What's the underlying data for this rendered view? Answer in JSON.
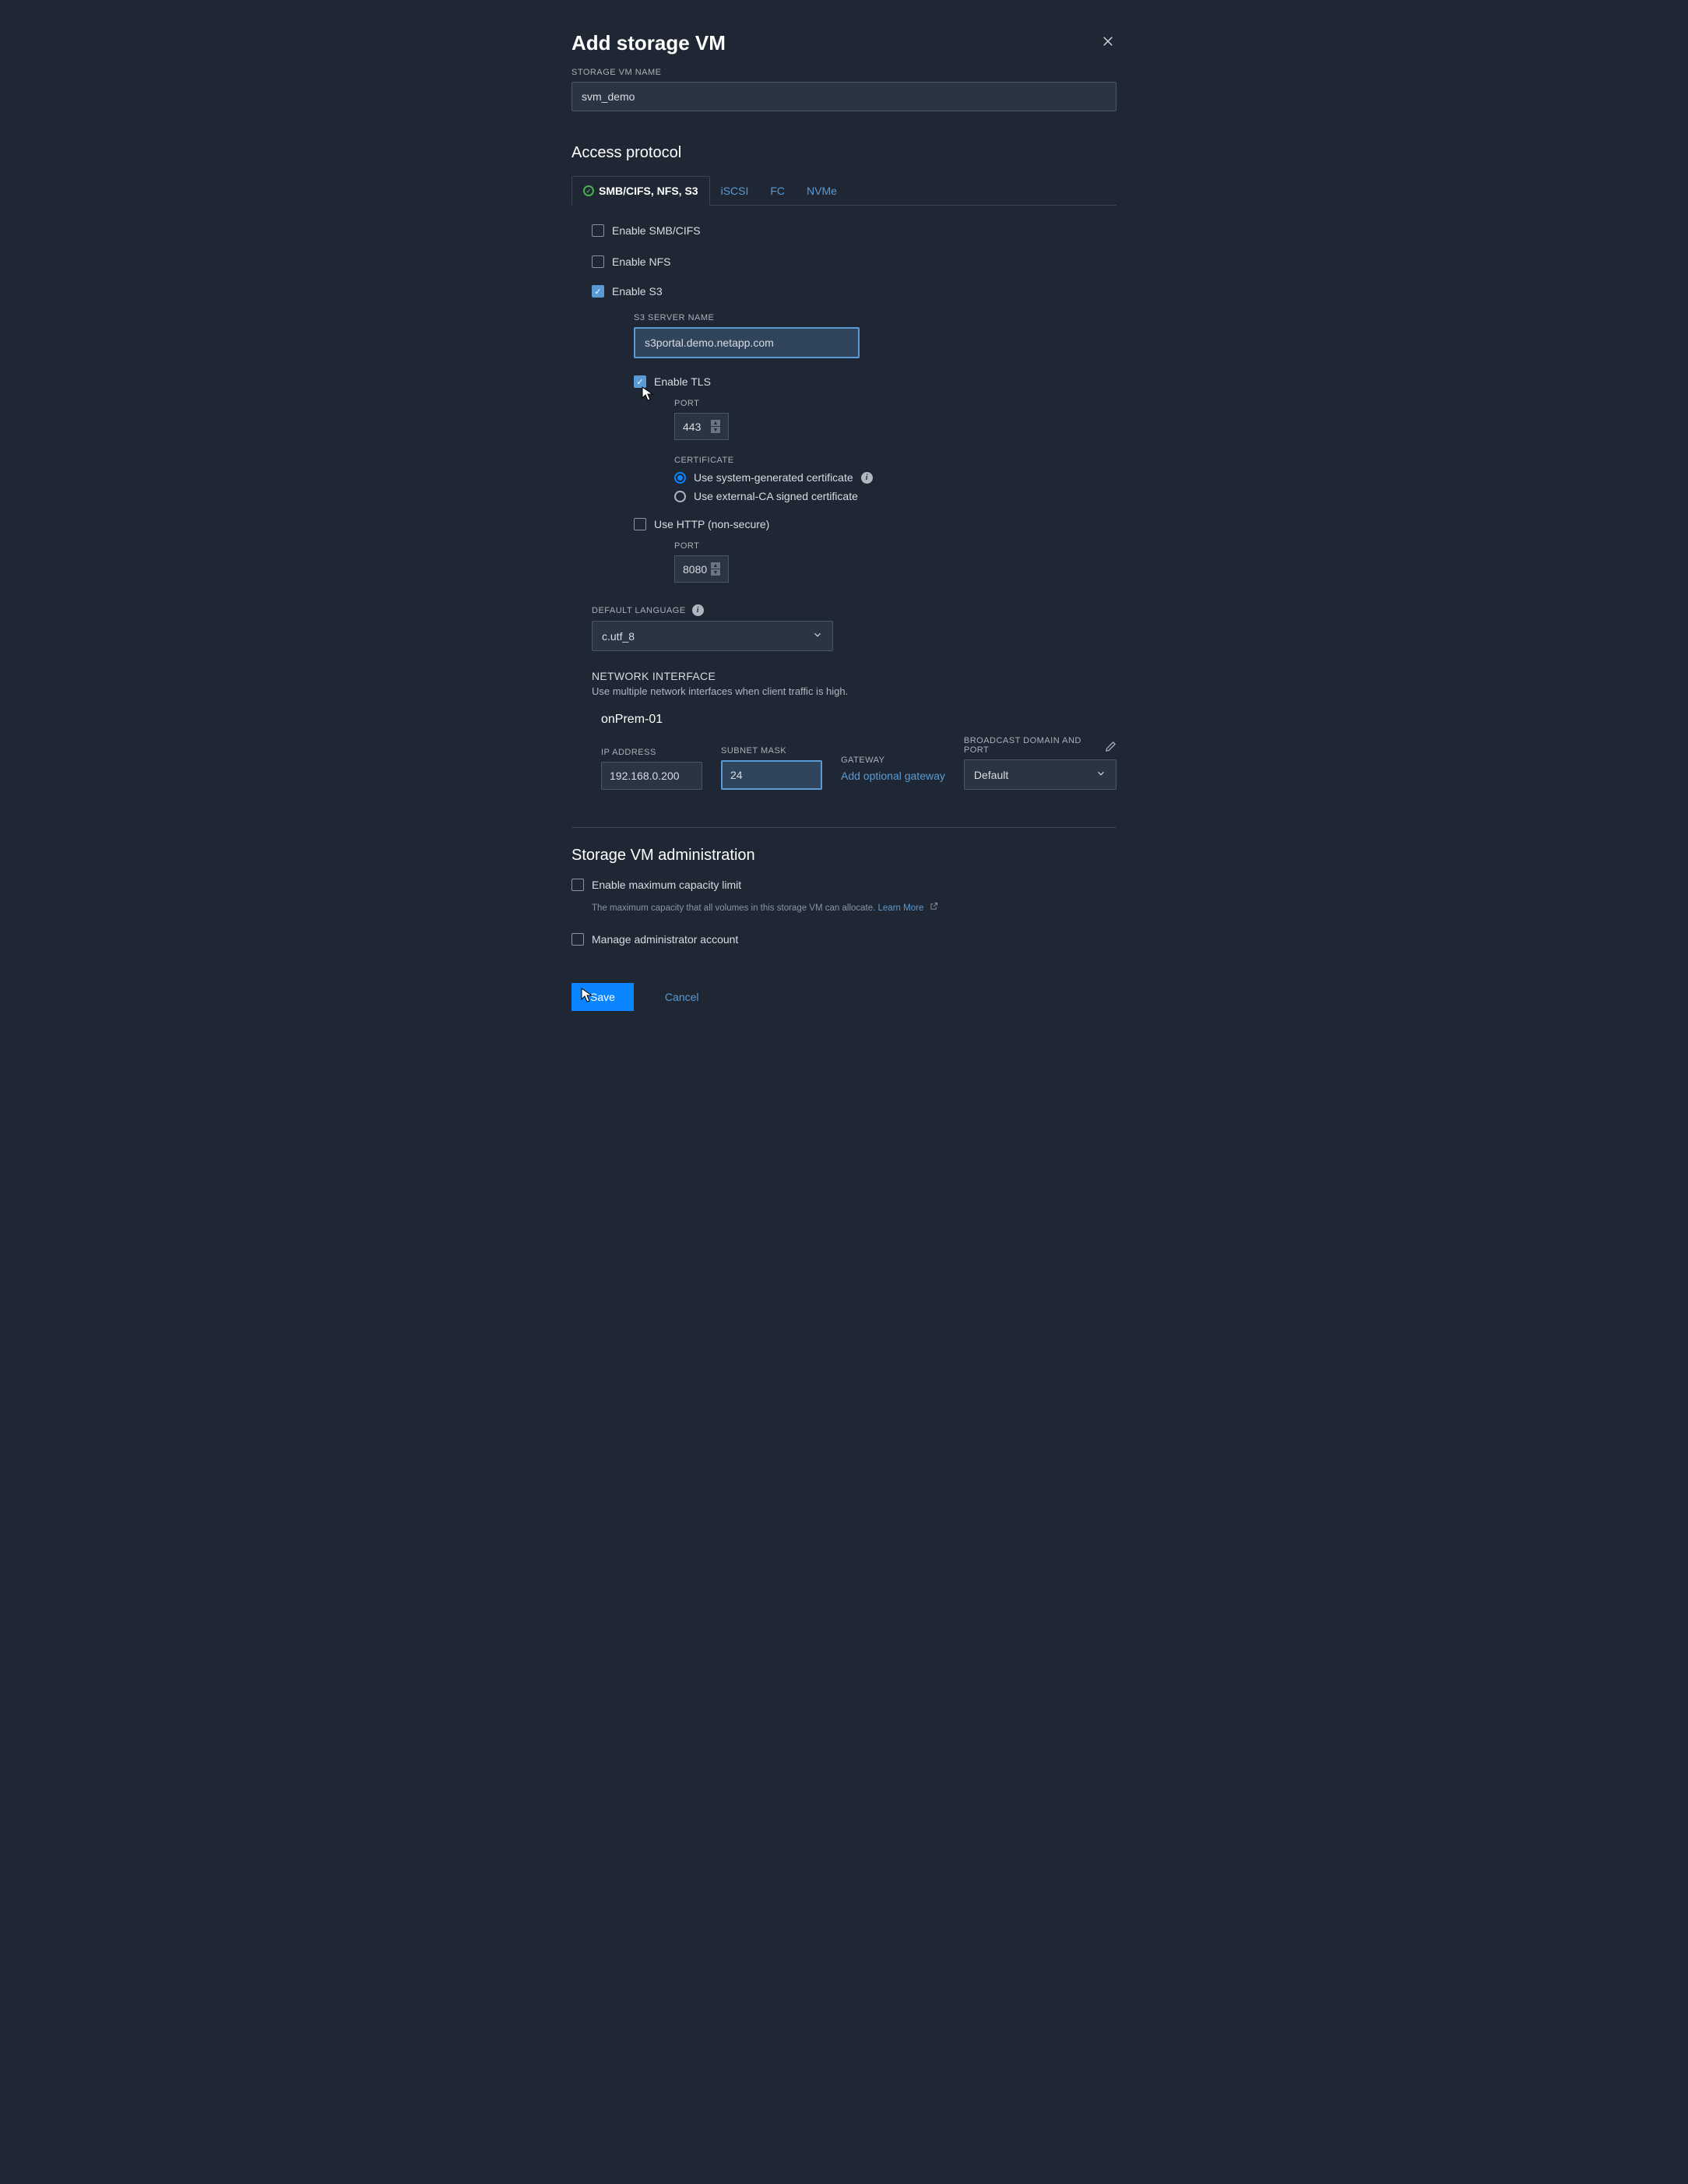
{
  "dialog": {
    "title": "Add storage VM",
    "storage_vm_name_label": "STORAGE VM NAME",
    "storage_vm_name_value": "svm_demo"
  },
  "access": {
    "heading": "Access protocol",
    "tabs": {
      "active": "SMB/CIFS, NFS, S3",
      "iscsi": "iSCSI",
      "fc": "FC",
      "nvme": "NVMe"
    },
    "enable_smb": "Enable SMB/CIFS",
    "enable_nfs": "Enable NFS",
    "enable_s3": "Enable S3",
    "s3_server_name_label": "S3 SERVER NAME",
    "s3_server_name_value": "s3portal.demo.netapp.com",
    "enable_tls": "Enable TLS",
    "port_label": "PORT",
    "tls_port": "443",
    "cert_label": "CERTIFICATE",
    "cert_system": "Use system-generated certificate",
    "cert_external": "Use external-CA signed certificate",
    "use_http": "Use HTTP (non-secure)",
    "http_port": "8080",
    "default_lang_label": "DEFAULT LANGUAGE",
    "default_lang_value": "c.utf_8"
  },
  "network": {
    "heading": "NETWORK INTERFACE",
    "subheading": "Use multiple network interfaces when client traffic is high.",
    "node": "onPrem-01",
    "ip_label": "IP ADDRESS",
    "ip_value": "192.168.0.200",
    "mask_label": "SUBNET MASK",
    "mask_value": "24",
    "gateway_label": "GATEWAY",
    "gateway_link": "Add optional gateway",
    "broadcast_label": "BROADCAST DOMAIN AND PORT",
    "broadcast_value": "Default"
  },
  "admin": {
    "heading": "Storage VM administration",
    "max_cap": "Enable maximum capacity limit",
    "max_cap_help": "The maximum capacity that all volumes in this storage VM can allocate.",
    "learn_more": "Learn More",
    "manage_admin": "Manage administrator account"
  },
  "buttons": {
    "save": "Save",
    "cancel": "Cancel"
  }
}
